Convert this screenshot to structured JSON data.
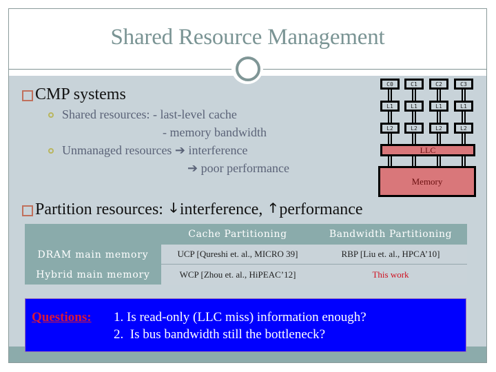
{
  "slide": {
    "title": "Shared Resource Management",
    "bullets": [
      {
        "text": "CMP systems",
        "sub": [
          {
            "text": "Shared resources: - last-level cache",
            "continuation": "- memory bandwidth"
          },
          {
            "text": "Unmanaged resources ➔ interference",
            "continuation": "➔ poor performance"
          }
        ]
      },
      {
        "text_parts": [
          "Partition resources: ",
          "interference, ",
          "performance"
        ],
        "arrows": [
          "down-arrow-icon",
          "up-arrow-icon"
        ],
        "arrow_glyphs": [
          "🠓",
          "🠑"
        ]
      }
    ]
  },
  "diagram": {
    "cores": [
      "C0",
      "C1",
      "C2",
      "C3"
    ],
    "l1": [
      "L1",
      "L1",
      "L1",
      "L1"
    ],
    "l2": [
      "L2",
      "L2",
      "L2",
      "L2"
    ],
    "llc": "LLC",
    "memory": "Memory",
    "colors": {
      "shared": "#d9777a",
      "private": "#c8d3d9"
    }
  },
  "table": {
    "headers": [
      "",
      "Cache Partitioning",
      "Bandwidth Partitioning"
    ],
    "rows": [
      {
        "label": "DRAM main memory",
        "cells": [
          "UCP [Qureshi et. al., MICRO 39]",
          "RBP [Liu et. al., HPCA’10]"
        ]
      },
      {
        "label": "Hybrid main memory",
        "cells": [
          "WCP [Zhou et. al., HiPEAC’12]",
          "This work"
        ]
      }
    ],
    "highlight_color": "#d01020"
  },
  "questions": {
    "label": "Questions:",
    "items": [
      "1. Is read-only (LLC miss) information enough?",
      "2.  Is bus bandwidth still the bottleneck?"
    ]
  }
}
